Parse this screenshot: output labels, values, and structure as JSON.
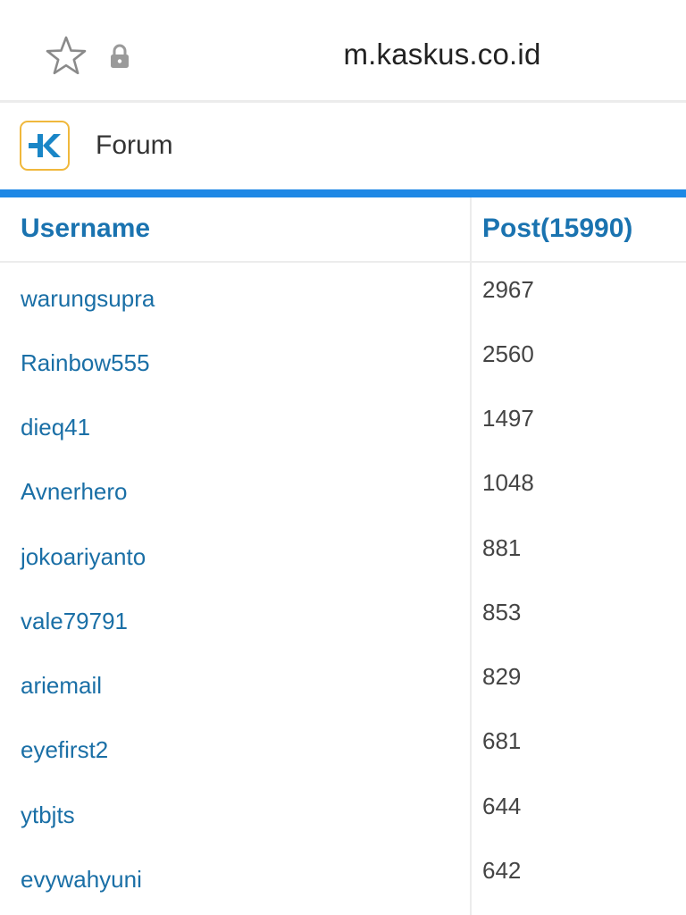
{
  "browser": {
    "url": "m.kaskus.co.id"
  },
  "header": {
    "logo_icon": "kaskus-logo-icon",
    "title": "Forum"
  },
  "table": {
    "columns": {
      "username": "Username",
      "post": "Post(15990)"
    },
    "rows": [
      {
        "username": "warungsupra",
        "post": "2967"
      },
      {
        "username": "Rainbow555",
        "post": "2560"
      },
      {
        "username": "dieq41",
        "post": "1497"
      },
      {
        "username": "Avnerhero",
        "post": "1048"
      },
      {
        "username": "jokoariyanto",
        "post": "881"
      },
      {
        "username": "vale79791",
        "post": "853"
      },
      {
        "username": "ariemail",
        "post": "829"
      },
      {
        "username": "eyefirst2",
        "post": "681"
      },
      {
        "username": "ytbjts",
        "post": "644"
      },
      {
        "username": "evywahyuni",
        "post": "642"
      }
    ]
  },
  "colors": {
    "accent_blue": "#1e88e5",
    "link_blue": "#1a6fa6",
    "logo_border": "#f0b83c"
  }
}
